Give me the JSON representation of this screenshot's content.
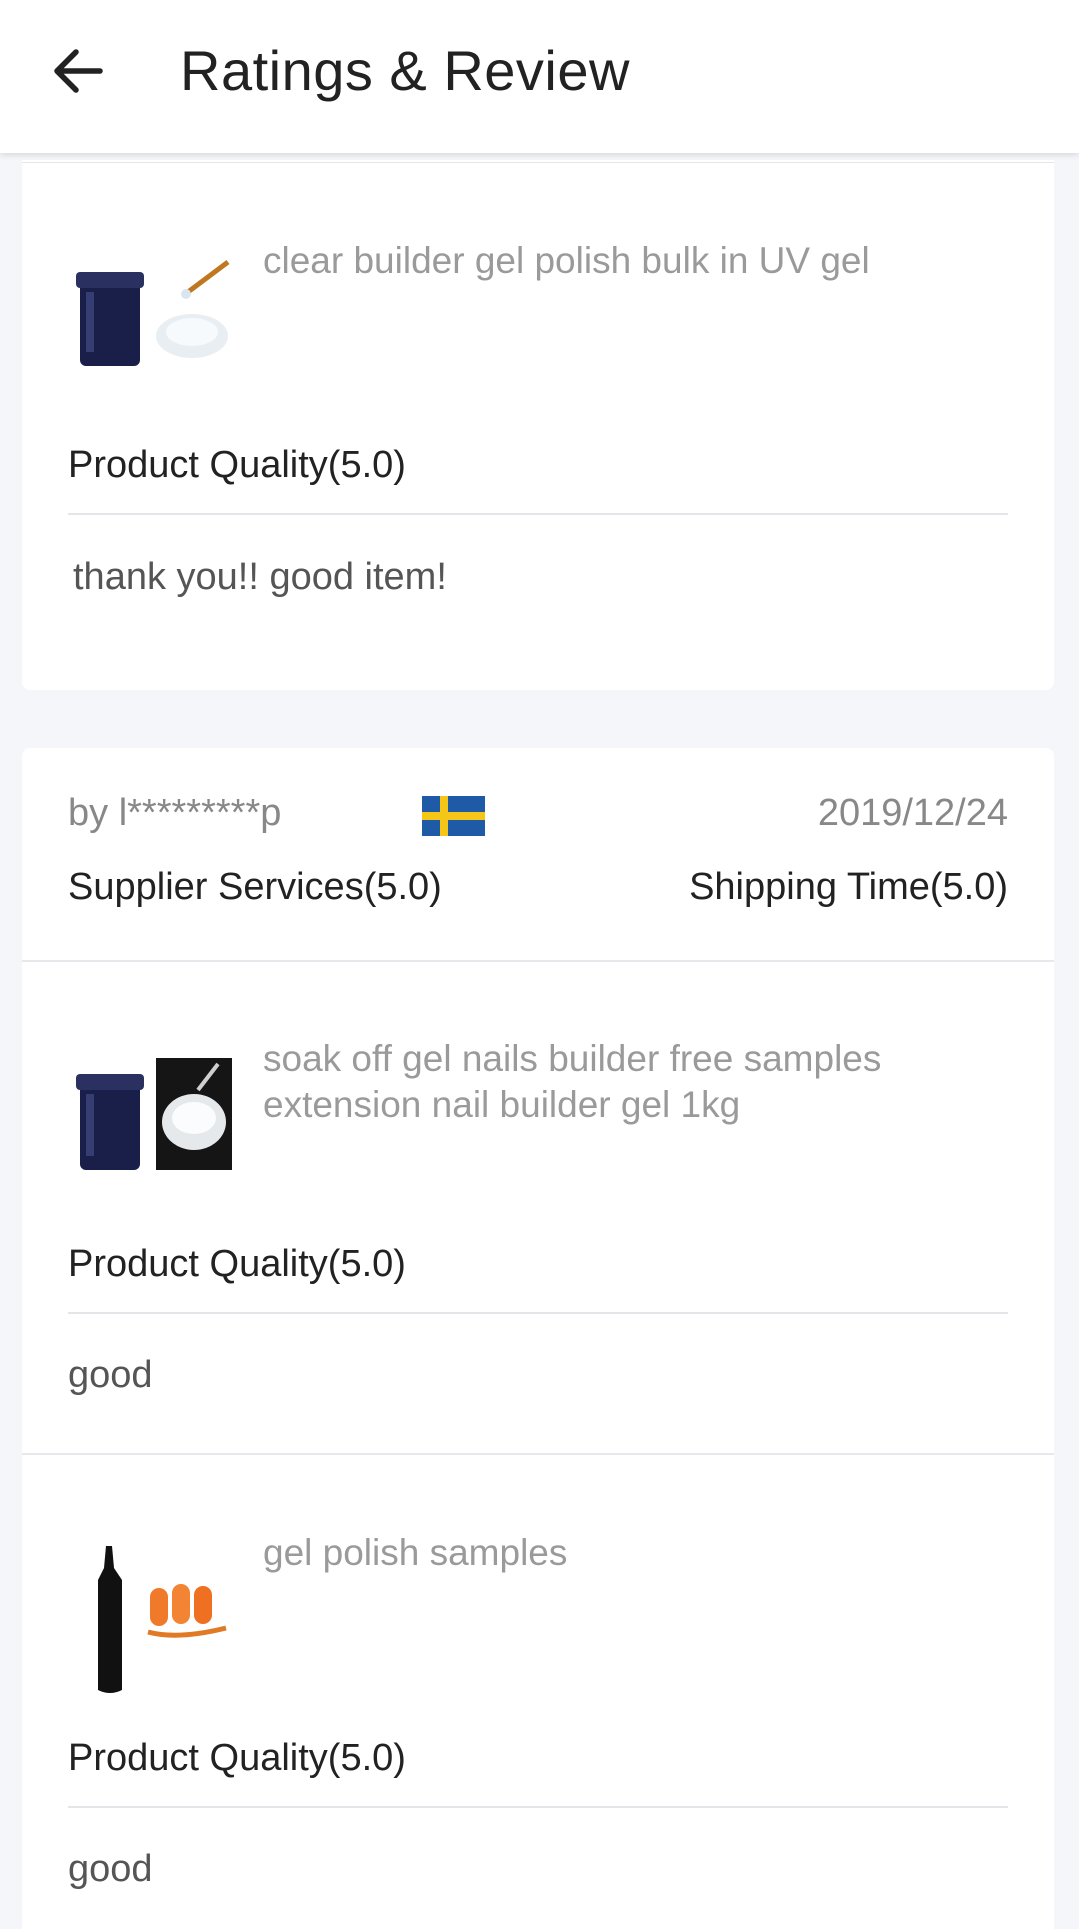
{
  "header": {
    "title": "Ratings & Review",
    "back_icon": "arrow-left-icon"
  },
  "review_1": {
    "product": {
      "name": "clear builder gel polish bulk in UV gel",
      "quality_label": "Product Quality(5.0)",
      "comment": "thank you!! good item!"
    }
  },
  "review_2": {
    "reviewer": "by l*********p",
    "country_flag": "sweden-flag-icon",
    "date": "2019/12/24",
    "supplier_services": "Supplier Services(5.0)",
    "shipping_time": "Shipping Time(5.0)",
    "products": [
      {
        "name_line1": "soak off gel nails builder free samples",
        "name_line2": "extension nail builder gel  1kg",
        "quality_label": "Product Quality(5.0)",
        "comment": "good"
      },
      {
        "name": "gel polish samples",
        "quality_label": "Product Quality(5.0)",
        "comment": "good"
      }
    ]
  },
  "colors": {
    "background": "#f4f6f9",
    "card": "#ffffff",
    "muted_text": "#9a9a9a",
    "flag_blue": "#1f5aa6",
    "flag_yellow": "#f5c518"
  }
}
